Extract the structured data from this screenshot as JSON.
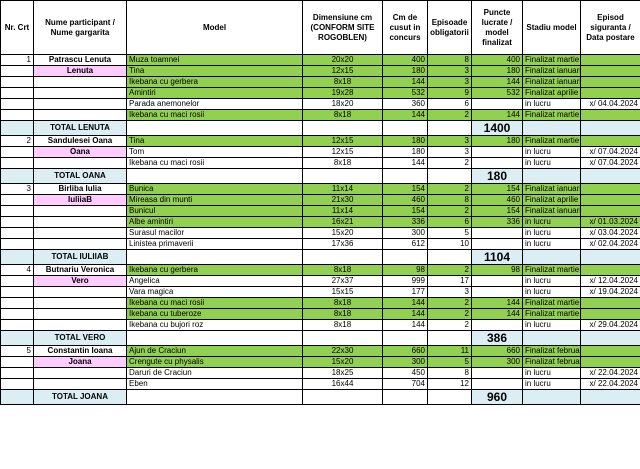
{
  "headers": {
    "nr": "Nr. Crt",
    "participant": "Nume participant / Nume gargarita",
    "model": "Model",
    "dim": "Dimensiune cm (CONFORM SITE ROGOBLEN)",
    "cm": "Cm de cusut in concurs",
    "episodes": "Episoade obligatorii",
    "points": "Puncte lucrate / model finalizat",
    "stage": "Stadiu model",
    "insurance": "Episod siguranta / Data postare"
  },
  "groups": [
    {
      "nr": "1",
      "name": "Patrascu Lenuta",
      "nick": "Lenuta",
      "total_label": "TOTAL LENUTA",
      "total": "1400",
      "rows": [
        {
          "model": "Muza toamnei",
          "dim": "20x20",
          "cm": "400",
          "ep": "8",
          "pts": "400",
          "stage": "Finalizat martie",
          "ins": "",
          "green": true
        },
        {
          "model": "Tina",
          "dim": "12x15",
          "cm": "180",
          "ep": "3",
          "pts": "180",
          "stage": "Finalizat ianuarie",
          "ins": "",
          "green": true
        },
        {
          "model": "Ikebana cu gerbera",
          "dim": "8x18",
          "cm": "144",
          "ep": "3",
          "pts": "144",
          "stage": "Finalizat ianuarie",
          "ins": "",
          "green": true
        },
        {
          "model": "Amintiri",
          "dim": "19x28",
          "cm": "532",
          "ep": "9",
          "pts": "532",
          "stage": "Finalizat aprilie",
          "ins": "",
          "green": true
        },
        {
          "model": "Parada anemonelor",
          "dim": "18x20",
          "cm": "360",
          "ep": "6",
          "pts": "",
          "stage": "in lucru",
          "ins": "x/ 04.04.2024",
          "green": false
        },
        {
          "model": "Ikebana cu maci rosii",
          "dim": "8x18",
          "cm": "144",
          "ep": "2",
          "pts": "144",
          "stage": "Finalizat martie",
          "ins": "",
          "green": true
        }
      ]
    },
    {
      "nr": "2",
      "name": "Sandulesei Oana",
      "nick": "Oana",
      "total_label": "TOTAL OANA",
      "total": "180",
      "rows": [
        {
          "model": "Tina",
          "dim": "12x15",
          "cm": "180",
          "ep": "3",
          "pts": "180",
          "stage": "Finalizat martie",
          "ins": "",
          "green": true
        },
        {
          "model": "Tom",
          "dim": "12x15",
          "cm": "180",
          "ep": "3",
          "pts": "",
          "stage": "in lucru",
          "ins": "x/ 07.04.2024",
          "green": false
        },
        {
          "model": "Ikebana cu maci rosii",
          "dim": "8x18",
          "cm": "144",
          "ep": "2",
          "pts": "",
          "stage": "in lucru",
          "ins": "x/ 07.04.2024",
          "green": false
        }
      ]
    },
    {
      "nr": "3",
      "name": "Birliba Iulia",
      "nick": "IuliiaB",
      "total_label": "TOTAL IULIIAB",
      "total": "1104",
      "rows": [
        {
          "model": "Bunica",
          "dim": "11x14",
          "cm": "154",
          "ep": "2",
          "pts": "154",
          "stage": "Finalizat ianuarie",
          "ins": "",
          "green": true
        },
        {
          "model": "Mireasa din munti",
          "dim": "21x30",
          "cm": "460",
          "ep": "8",
          "pts": "460",
          "stage": "Finalizat aprilie",
          "ins": "",
          "green": true
        },
        {
          "model": "Bunicul",
          "dim": "11x14",
          "cm": "154",
          "ep": "2",
          "pts": "154",
          "stage": "Finalizat ianuarie",
          "ins": "",
          "green": true
        },
        {
          "model": "Albe amintiri",
          "dim": "16x21",
          "cm": "336",
          "ep": "6",
          "pts": "336",
          "stage": "in lucru",
          "ins": "x/ 01.03.2024",
          "green": true
        },
        {
          "model": "Surasul macilor",
          "dim": "15x20",
          "cm": "300",
          "ep": "5",
          "pts": "",
          "stage": "in lucru",
          "ins": "x/ 03.04.2024",
          "green": false
        },
        {
          "model": "Linistea primaverii",
          "dim": "17x36",
          "cm": "612",
          "ep": "10",
          "pts": "",
          "stage": "in lucru",
          "ins": "x/ 02.04.2024",
          "green": false
        }
      ]
    },
    {
      "nr": "4",
      "name": "Butnariu Veronica",
      "nick": "Vero",
      "total_label": "TOTAL VERO",
      "total": "386",
      "rows": [
        {
          "model": "Ikebana cu gerbera",
          "dim": "8x18",
          "cm": "98",
          "ep": "2",
          "pts": "98",
          "stage": "Finalizat martie",
          "ins": "",
          "green": true
        },
        {
          "model": "Angelica",
          "dim": "27x37",
          "cm": "999",
          "ep": "17",
          "pts": "",
          "stage": "in lucru",
          "ins": "x/ 12.04.2024",
          "green": false
        },
        {
          "model": "Vara magica",
          "dim": "15x15",
          "cm": "177",
          "ep": "3",
          "pts": "",
          "stage": "in lucru",
          "ins": "x/ 19.04.2024",
          "green": false
        },
        {
          "model": "Ikebana cu maci rosii",
          "dim": "8x18",
          "cm": "144",
          "ep": "2",
          "pts": "144",
          "stage": "Finalizat martie",
          "ins": "",
          "green": true
        },
        {
          "model": "Ikebana cu tuberoze",
          "dim": "8x18",
          "cm": "144",
          "ep": "2",
          "pts": "144",
          "stage": "Finalizat martie",
          "ins": "",
          "green": true
        },
        {
          "model": "Ikebana cu bujori roz",
          "dim": "8x18",
          "cm": "144",
          "ep": "2",
          "pts": "",
          "stage": "in lucru",
          "ins": "x/ 29.04.2024",
          "green": false
        }
      ]
    },
    {
      "nr": "5",
      "name": "Constantin Ioana",
      "nick": "Joana",
      "total_label": "TOTAL JOANA",
      "total": "960",
      "rows": [
        {
          "model": "Ajun de Craciun",
          "dim": "22x30",
          "cm": "660",
          "ep": "11",
          "pts": "660",
          "stage": "Finalizat februarie",
          "ins": "",
          "green": true
        },
        {
          "model": "Crengute cu physalis",
          "dim": "15x20",
          "cm": "300",
          "ep": "5",
          "pts": "300",
          "stage": "Finalizat februarie",
          "ins": "",
          "green": true
        },
        {
          "model": "Daruri de Craciun",
          "dim": "18x25",
          "cm": "450",
          "ep": "8",
          "pts": "",
          "stage": "in lucru",
          "ins": "x/ 22.04.2024",
          "green": false
        },
        {
          "model": "Eben",
          "dim": "16x44",
          "cm": "704",
          "ep": "12",
          "pts": "",
          "stage": "in lucru",
          "ins": "x/ 22.04.2024",
          "green": false
        }
      ]
    }
  ],
  "colors": {
    "done_row": "#92d050",
    "nick_cell": "#ffccff",
    "total_row": "#daeef3",
    "grid": "#000000"
  }
}
